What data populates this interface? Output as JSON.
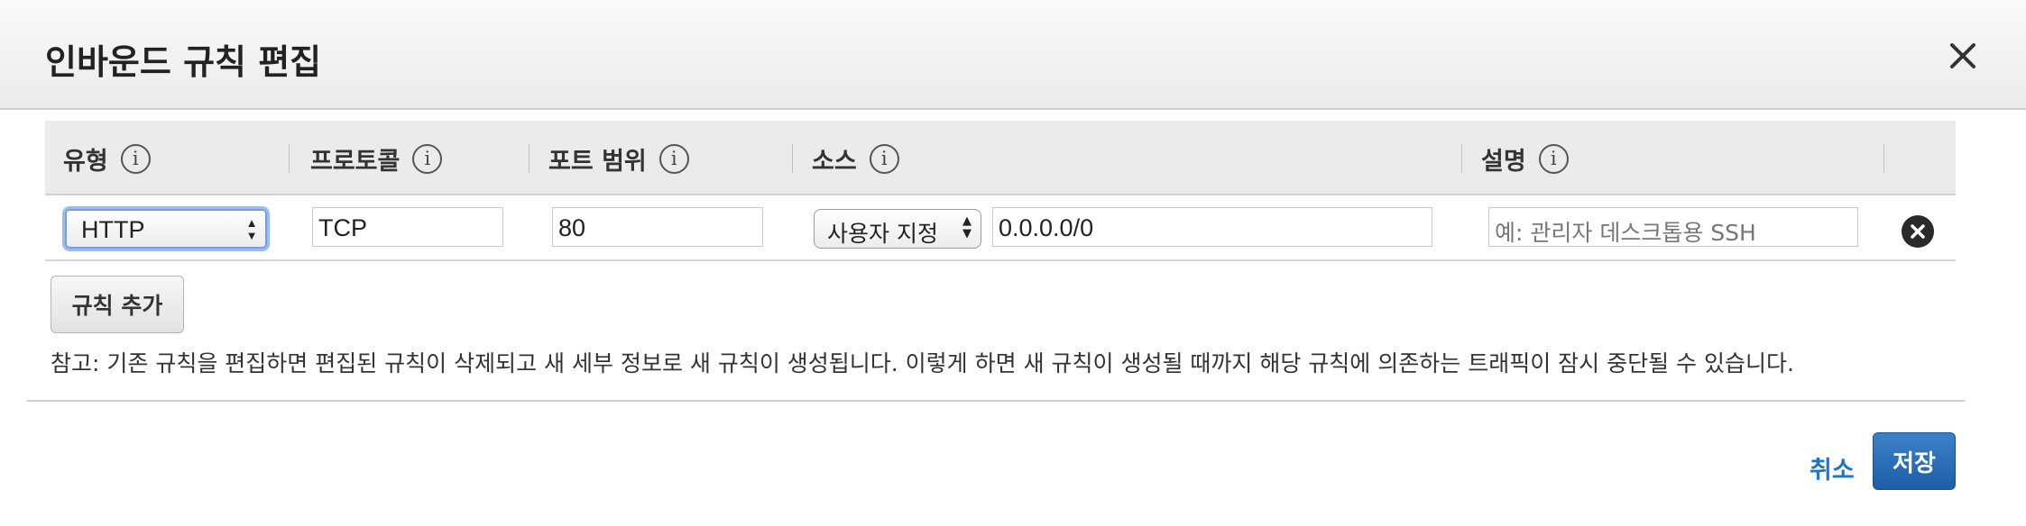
{
  "dialog": {
    "title": "인바운드 규칙 편집",
    "close_icon": "close-icon"
  },
  "table": {
    "headers": [
      {
        "label": "유형",
        "icon": "info-icon"
      },
      {
        "label": "프로토콜",
        "icon": "info-icon"
      },
      {
        "label": "포트 범위",
        "icon": "info-icon"
      },
      {
        "label": "소스",
        "icon": "info-icon"
      },
      {
        "label": "설명",
        "icon": "info-icon"
      }
    ],
    "rows": [
      {
        "type": "HTTP",
        "protocol": "TCP",
        "port_range": "80",
        "source_mode": "사용자 지정",
        "source_cidr": "0.0.0.0/0",
        "description_placeholder": "예: 관리자 데스크톱용 SSH",
        "remove_icon": "remove-circle-icon"
      }
    ]
  },
  "actions": {
    "add_rule": "규칙 추가",
    "note": "참고: 기존 규칙을 편집하면 편집된 규칙이 삭제되고 새 세부 정보로 새 규칙이 생성됩니다. 이렇게 하면 새 규칙이 생성될 때까지 해당 규칙에 의존하는 트래픽이 잠시 중단될 수 있습니다.",
    "cancel": "취소",
    "save": "저장"
  },
  "colors": {
    "primary_button": "#1c5ea8",
    "link": "#1f74c7",
    "focus_ring": "#9bbdf3"
  }
}
